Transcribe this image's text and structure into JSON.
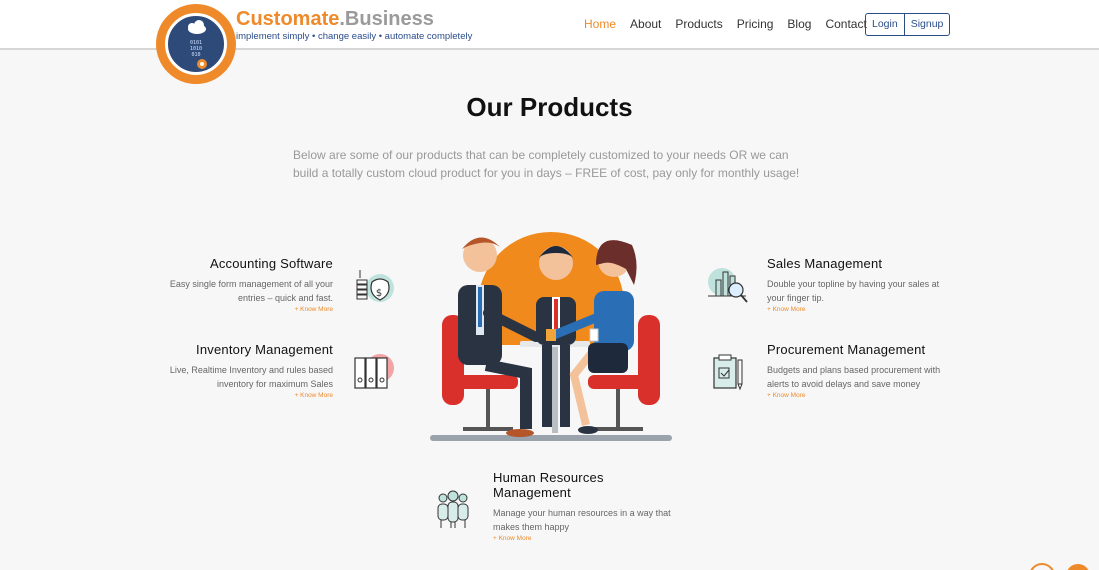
{
  "brand": {
    "name_main": "Customate",
    "name_suffix": ".Business",
    "tagline": "implement simply • change easily • automate completely",
    "logo_code": "0101\n1010\n010\n10",
    "colors": {
      "orange": "#ef8a2a",
      "navy": "#2e4a78",
      "blue": "#2a4d8a"
    }
  },
  "nav": {
    "items": [
      "Home",
      "About",
      "Products",
      "Pricing",
      "Blog",
      "Contact"
    ],
    "active": "Home",
    "login": "Login",
    "signup": "Signup"
  },
  "page": {
    "title": "Our Products",
    "lead": "Below are some of our products that can be completely customized to your needs OR we can build a totally custom cloud product for you in days – FREE of cost, pay only for monthly usage!"
  },
  "products": {
    "accounting": {
      "title": "Accounting Software",
      "desc": "Easy single form management of all your entries – quick and fast.",
      "link": "+ Know More",
      "icon": "money-bag-icon"
    },
    "inventory": {
      "title": "Inventory Management",
      "desc": "Live, Realtime Inventory and rules based inventory for maximum Sales",
      "link": "+ Know More",
      "icon": "binders-icon"
    },
    "sales": {
      "title": "Sales Management",
      "desc": "Double your topline by having your sales at your finger tip.",
      "link": "+ Know More",
      "icon": "chart-magnifier-icon"
    },
    "procurement": {
      "title": "Procurement Management",
      "desc": "Budgets and plans based procurement with alerts to avoid delays and save money",
      "link": "+ Know More",
      "icon": "clipboard-icon"
    },
    "hr": {
      "title_line1": "Human Resources",
      "title_line2": "Management",
      "desc": "Manage your human resources in a way that makes them happy",
      "link": "+ Know More",
      "icon": "team-icon"
    }
  },
  "illustration": {
    "icon": "business-meeting-illustration"
  }
}
